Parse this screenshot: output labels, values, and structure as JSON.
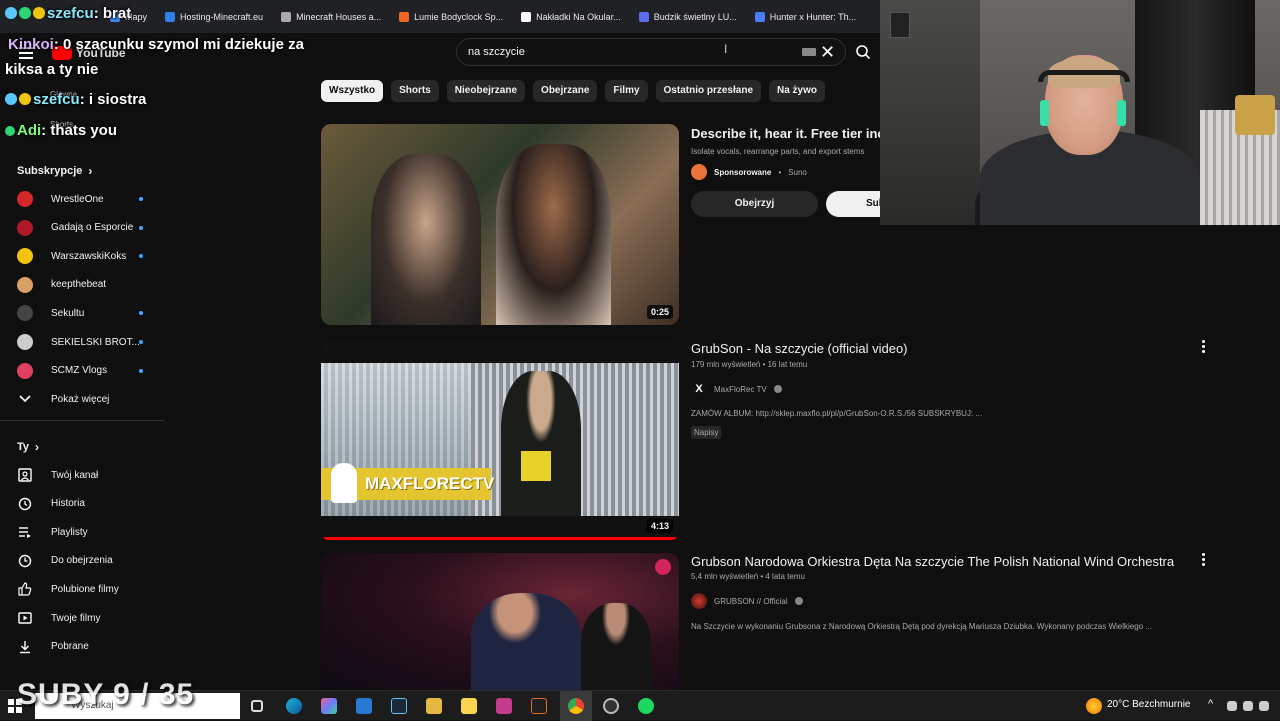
{
  "bookmarks": [
    {
      "label": "Mapy",
      "color": "#4285f4"
    },
    {
      "label": "Hosting-Minecraft.eu",
      "color": "#2f80ed"
    },
    {
      "label": "Minecraft Houses a...",
      "color": "#aaaaaa"
    },
    {
      "label": "Lumie Bodyclock Sp...",
      "color": "#f26522"
    },
    {
      "label": "Nakładki Na Okular...",
      "color": "#ffffff"
    },
    {
      "label": "Budzik świetlny LU...",
      "color": "#5b6bf0"
    },
    {
      "label": "Hunter x Hunter: Th...",
      "color": "#4a7cff"
    }
  ],
  "youtube": {
    "logo_text": "YouTube",
    "search_value": "na szczycie",
    "chips": [
      "Wszystko",
      "Shorts",
      "Nieobejrzane",
      "Obejrzane",
      "Filmy",
      "Ostatnio przesłane",
      "Na żywo"
    ],
    "nav": {
      "home": "Główna",
      "shorts": "Shorts"
    }
  },
  "sidebar": {
    "subs_header": "Subskrypcje",
    "subs": [
      {
        "name": "WrestleOne",
        "color": "#d62828",
        "live": true
      },
      {
        "name": "Gadają o Esporcie",
        "color": "#b0182a",
        "live": true
      },
      {
        "name": "WarszawskiKoks",
        "color": "#f4c20d",
        "live": true
      },
      {
        "name": "keepthebeat",
        "color": "#d9a066",
        "live": false
      },
      {
        "name": "Sekultu",
        "color": "#444444",
        "live": true
      },
      {
        "name": "SEKIELSKI BROT...",
        "color": "#cccccc",
        "live": true
      },
      {
        "name": "SCMZ Vlogs",
        "color": "#e04060",
        "live": true
      }
    ],
    "show_more": "Pokaż więcej",
    "you_header": "Ty",
    "you_items": [
      {
        "label": "Twój kanał",
        "icon": "user-square-icon"
      },
      {
        "label": "Historia",
        "icon": "history-icon"
      },
      {
        "label": "Playlisty",
        "icon": "playlist-icon"
      },
      {
        "label": "Do obejrzenia",
        "icon": "clock-icon"
      },
      {
        "label": "Polubione filmy",
        "icon": "thumb-up-icon"
      },
      {
        "label": "Twoje filmy",
        "icon": "play-square-icon"
      },
      {
        "label": "Pobrane",
        "icon": "download-icon"
      }
    ]
  },
  "ad": {
    "title": "Describe it, hear it. Free tier includ",
    "desc": "Isolate vocals, rearrange parts, and export stems ",
    "sponsored": "Sponsorowane",
    "advertiser": "Suno",
    "duration": "0:25",
    "watch_button": "Obejrzyj",
    "subscribe_button": "Sub"
  },
  "videos": [
    {
      "title": "GrubSon - Na szczycie (official video)",
      "meta": "179 mln wyświetleń • 16 lat temu",
      "channel": "MaxFloRec TV",
      "desc": "ZAMÓW ALBUM: http://sklep.maxflo.pl/pl/p/GrubSon-O.R.S./56 SUBSKRYBUJ: ...",
      "tag": "Napisy",
      "duration": "4:13",
      "thumb_label": "MAXFLORECTV"
    },
    {
      "title": "Grubson Narodowa Orkiestra Dęta Na szczycie The Polish National Wind Orchestra",
      "meta": "5,4 mln wyświetleń • 4 lata temu",
      "channel": "GRUBSON // Official",
      "desc": "Na Szczycie w wykonaniu Grubsona z Narodową Orkiestrą Dętą pod dyrekcją Mariusza Dziubka. Wykonany podczas Wielkiego ..."
    }
  ],
  "chat": [
    {
      "user": "szefcu",
      "text": ": brat"
    },
    {
      "user": "Kinkoi",
      "text": ": 0 szacunku szymol mi dziekuje za"
    },
    {
      "user": "",
      "text": "kiksa a ty nie"
    },
    {
      "user": "szefcu",
      "text": ": i siostra"
    },
    {
      "user": "Adi",
      "text": ": thats you"
    }
  ],
  "overlay": {
    "suby": "SUBY 9 / 35"
  },
  "taskbar": {
    "search_placeholder": "Wyszukaj",
    "weather": "20°C  Bezchmurnie"
  }
}
